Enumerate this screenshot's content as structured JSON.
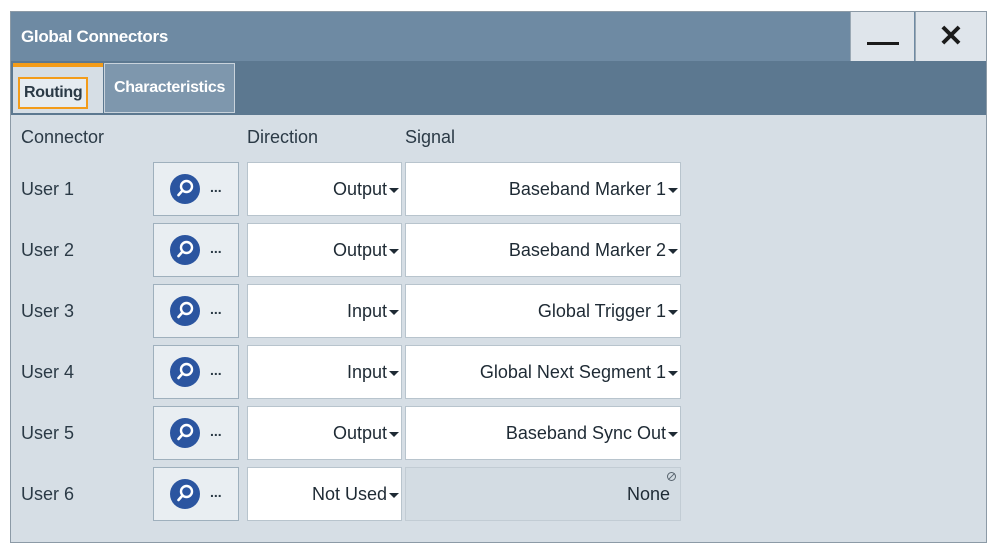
{
  "window": {
    "title": "Global Connectors",
    "minimize_icon": "minimize-icon",
    "close_icon": "close-icon",
    "close_glyph": "✕"
  },
  "tabs": [
    {
      "label": "Routing",
      "active": true
    },
    {
      "label": "Characteristics",
      "active": false
    }
  ],
  "table": {
    "headers": {
      "connector": "Connector",
      "direction": "Direction",
      "signal": "Signal"
    },
    "rows": [
      {
        "connector": "User 1",
        "selector_dots": "...",
        "direction": "Output",
        "signal": "Baseband Marker 1",
        "signal_enabled": true
      },
      {
        "connector": "User 2",
        "selector_dots": "...",
        "direction": "Output",
        "signal": "Baseband Marker 2",
        "signal_enabled": true
      },
      {
        "connector": "User 3",
        "selector_dots": "...",
        "direction": "Input",
        "signal": "Global Trigger 1",
        "signal_enabled": true
      },
      {
        "connector": "User 4",
        "selector_dots": "...",
        "direction": "Input",
        "signal": "Global Next Segment 1",
        "signal_enabled": true
      },
      {
        "connector": "User 5",
        "selector_dots": "...",
        "direction": "Output",
        "signal": "Baseband Sync Out",
        "signal_enabled": true
      },
      {
        "connector": "User 6",
        "selector_dots": "...",
        "direction": "Not Used",
        "signal": "None",
        "signal_enabled": false
      }
    ]
  },
  "colors": {
    "titlebar": "#6e8aa3",
    "tabstrip": "#5c7890",
    "panel": "#d6dee5",
    "accent": "#f39c1a",
    "selector_circle": "#2b55a0"
  }
}
